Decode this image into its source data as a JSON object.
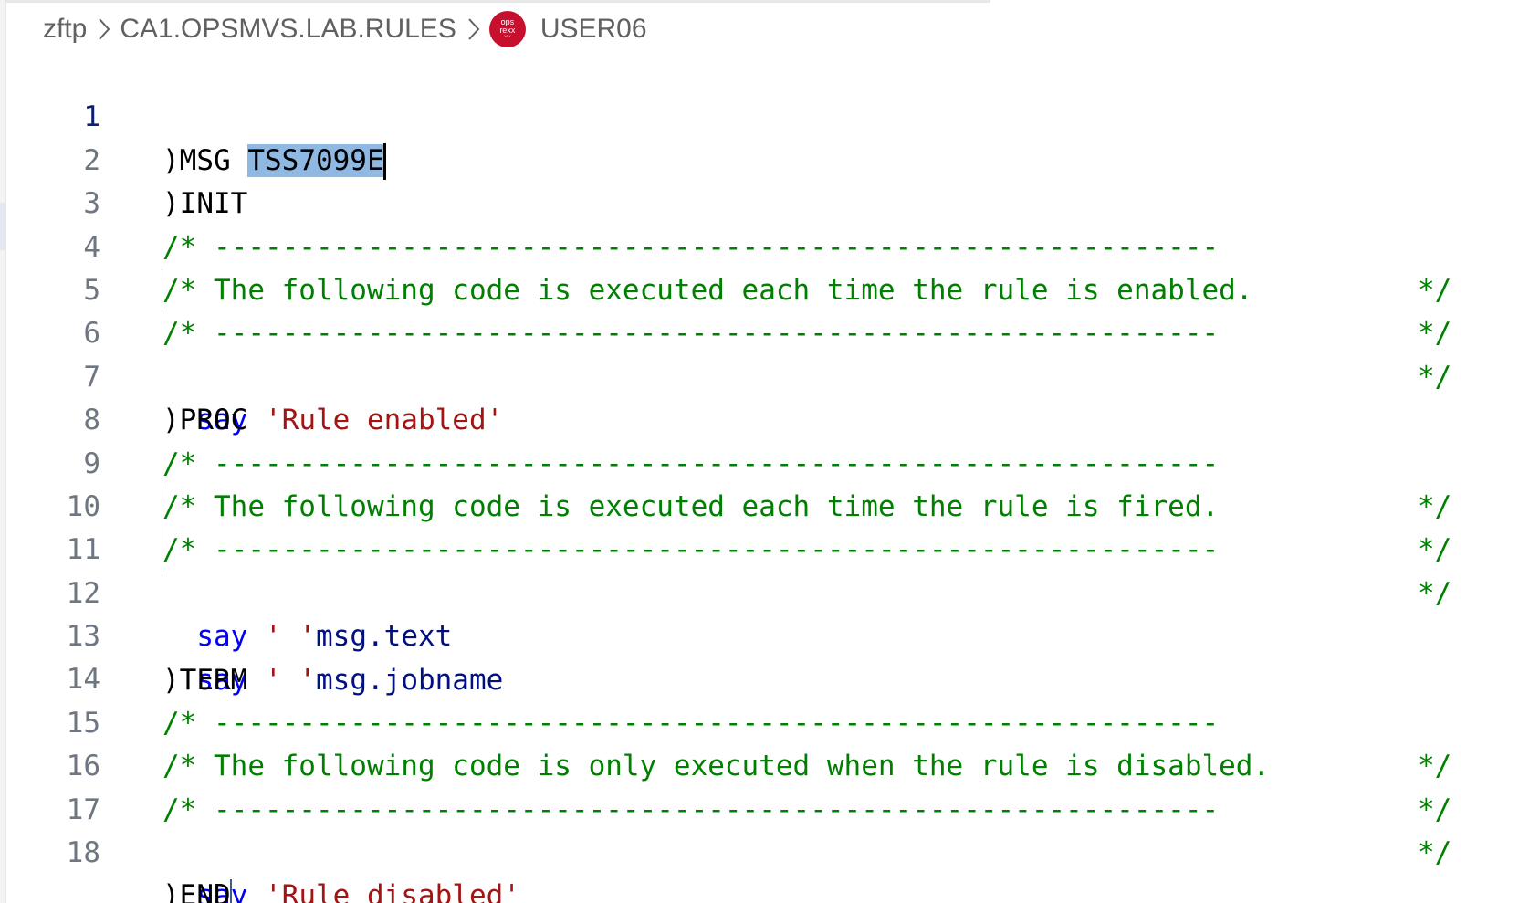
{
  "breadcrumb": {
    "items": [
      "zftp",
      "CA1.OPSMVS.LAB.RULES"
    ],
    "icon_text_top": "ops",
    "icon_text_bottom": "rexx",
    "icon_color": "#c8102e",
    "current": "USER06"
  },
  "editor": {
    "active_line": 1,
    "selection": "TSS7099E",
    "lines": [
      {
        "n": "1",
        "directive": ")MSG",
        "selected": "TSS7099E"
      },
      {
        "n": "2",
        "directive": ")INIT"
      },
      {
        "n": "3",
        "comment": "/* -----------------------------------------------------------",
        "comment_end": "*/"
      },
      {
        "n": "4",
        "comment": "/* The following code is executed each time the rule is enabled.",
        "comment_end": "*/"
      },
      {
        "n": "5",
        "comment": "/* -----------------------------------------------------------",
        "comment_end": "*/"
      },
      {
        "n": "6",
        "keyword": "say",
        "string": "'Rule enabled'"
      },
      {
        "n": "7",
        "directive": ")PROC"
      },
      {
        "n": "8",
        "comment": "/* -----------------------------------------------------------",
        "comment_end": "*/"
      },
      {
        "n": "9",
        "comment": "/* The following code is executed each time the rule is fired.",
        "comment_end": "*/"
      },
      {
        "n": "10",
        "comment": "/* -----------------------------------------------------------",
        "comment_end": "*/"
      },
      {
        "n": "11",
        "keyword": "say",
        "string": "' '",
        "variable": "msg.text"
      },
      {
        "n": "12",
        "keyword": "say",
        "string": "' '",
        "variable": "msg.jobname"
      },
      {
        "n": "13",
        "directive": ")TERM"
      },
      {
        "n": "14",
        "comment": "/* -----------------------------------------------------------",
        "comment_end": "*/"
      },
      {
        "n": "15",
        "comment": "/* The following code is only executed when the rule is disabled.",
        "comment_end": "*/"
      },
      {
        "n": "16",
        "comment": "/* -----------------------------------------------------------",
        "comment_end": "*/"
      },
      {
        "n": "17",
        "keyword": "say",
        "string": "'Rule disabled'"
      },
      {
        "n": "18",
        "directive": ")END"
      }
    ]
  },
  "colors": {
    "keyword": "#0000ff",
    "string": "#a31515",
    "variable": "#001080",
    "comment": "#008000",
    "selection": "#8fb8e3"
  }
}
